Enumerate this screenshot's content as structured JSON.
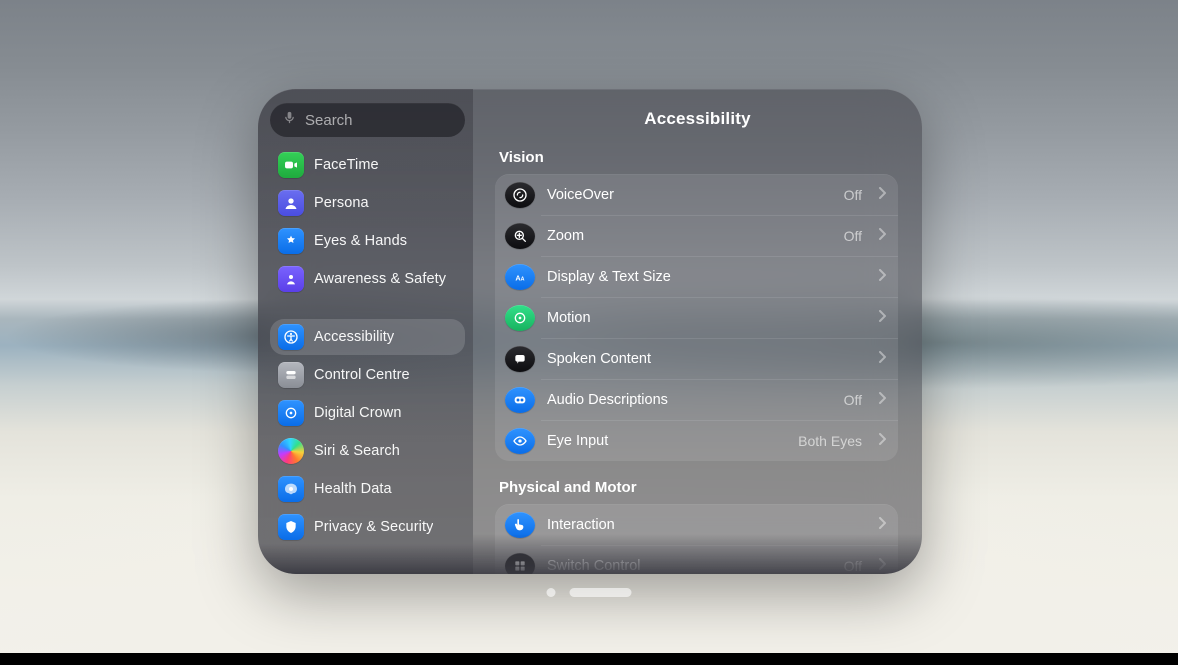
{
  "header": {
    "title": "Accessibility"
  },
  "search": {
    "placeholder": "Search"
  },
  "sidebar": {
    "items": [
      {
        "label": "FaceTime"
      },
      {
        "label": "Persona"
      },
      {
        "label": "Eyes & Hands"
      },
      {
        "label": "Awareness & Safety"
      },
      {
        "label": "Accessibility"
      },
      {
        "label": "Control Centre"
      },
      {
        "label": "Digital Crown"
      },
      {
        "label": "Siri & Search"
      },
      {
        "label": "Health Data"
      },
      {
        "label": "Privacy & Security"
      }
    ]
  },
  "sections": [
    {
      "label": "Vision",
      "rows": [
        {
          "label": "VoiceOver",
          "value": "Off"
        },
        {
          "label": "Zoom",
          "value": "Off"
        },
        {
          "label": "Display & Text Size",
          "value": ""
        },
        {
          "label": "Motion",
          "value": ""
        },
        {
          "label": "Spoken Content",
          "value": ""
        },
        {
          "label": "Audio Descriptions",
          "value": "Off"
        },
        {
          "label": "Eye Input",
          "value": "Both Eyes"
        }
      ]
    },
    {
      "label": "Physical and Motor",
      "rows": [
        {
          "label": "Interaction",
          "value": ""
        },
        {
          "label": "Switch Control",
          "value": "Off"
        }
      ]
    }
  ],
  "colors": {
    "accent_blue": "#0a6de8",
    "accent_green": "#1fab3e",
    "window_bg": "rgba(60,60,68,.55)"
  }
}
